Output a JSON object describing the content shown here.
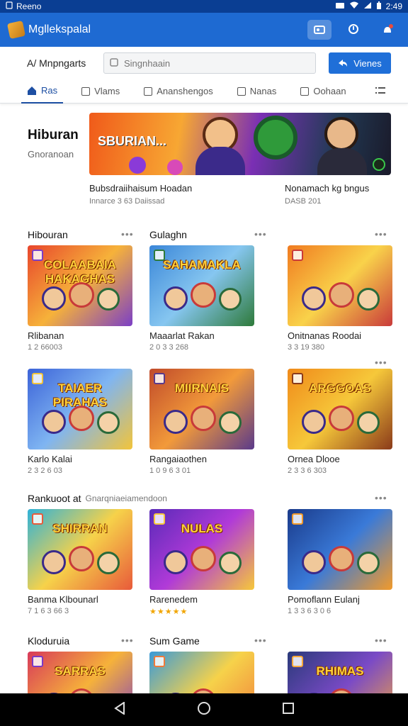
{
  "status_bar": {
    "left_text": "Reeno",
    "time": "2:49"
  },
  "app_bar": {
    "title": "Mgllekspalal"
  },
  "search": {
    "label": "A/ Mnpngarts",
    "placeholder": "Singnhaain",
    "button_label": "Vienes"
  },
  "tabs": [
    {
      "label": "Ras"
    },
    {
      "label": "Vlams"
    },
    {
      "label": "Ananshengos"
    },
    {
      "label": "Nanas"
    },
    {
      "label": "Oohaan"
    }
  ],
  "hero": {
    "title": "Hiburan",
    "subtitle": "Gnoranoan",
    "banner_text": "SBURIAN...",
    "caption_left": "Bubsdraiihaisum Hoadan",
    "meta_left": "Innarce 3 63 Daiissad",
    "caption_right": "Nonamach kg bngus",
    "meta_right": "DASB 201"
  },
  "sections": [
    {
      "title": "Hibouran",
      "second_title": "Gulaghn",
      "cards": [
        {
          "thumb_title": "COLAABAIA\nHAKAGHAS",
          "name": "Rlibanan",
          "meta": "1 2 66003",
          "palette": [
            "#e8452c",
            "#f6b23a",
            "#7b3fc6"
          ]
        },
        {
          "thumb_title": "SAHAMAKLA",
          "name": "Maaarlat Rakan",
          "meta": "2 0 3 3 268",
          "palette": [
            "#3a86d8",
            "#86c6f0",
            "#2e7a3a"
          ]
        },
        {
          "thumb_title": "",
          "name": "Onitnanas Roodai",
          "meta": "3 3 19 380",
          "palette": [
            "#f07a20",
            "#f9d24a",
            "#c93a3a"
          ]
        }
      ]
    },
    {
      "title": "",
      "second_title": "",
      "cards": [
        {
          "thumb_title": "TAIAER\nPIRAHAS",
          "name": "Karlo Kalai",
          "meta": "2 3 2 6 03",
          "palette": [
            "#3c63d8",
            "#7fb5f2",
            "#f2c43a"
          ]
        },
        {
          "thumb_title": "MIIRNAIS",
          "name": "Rangaiaothen",
          "meta": "1 0 9 6 3 01",
          "palette": [
            "#c04a2a",
            "#f29a3a",
            "#5a3a8a"
          ]
        },
        {
          "thumb_title": "ARGGOAS",
          "name": "Ornea Dlooe",
          "meta": "2 3 3 6 303",
          "palette": [
            "#f08a1a",
            "#f6c83a",
            "#8a3a1a"
          ]
        }
      ]
    },
    {
      "title": "Rankuoot at",
      "subtitle_suffix": "Gnarqniaeiamendoon",
      "cards": [
        {
          "thumb_title": "SHIRRAN",
          "name": "Banma Klbounarl",
          "meta": "7 1 6 3 66 3",
          "palette": [
            "#2fb2d8",
            "#f6d24a",
            "#e85a3a"
          ]
        },
        {
          "thumb_title": "NULAS",
          "name": "Rarenedem",
          "meta": "★★★★★",
          "palette": [
            "#5a2ab8",
            "#b03ad8",
            "#f6c83a"
          ]
        },
        {
          "thumb_title": "",
          "name": "Pomoflann Eulanj",
          "meta": "1 3 3 6 3 0 6",
          "palette": [
            "#1a3a8a",
            "#3a7ad8",
            "#f29a2a"
          ]
        }
      ]
    },
    {
      "title": "Kloduruia",
      "second_title": "Sum Game",
      "cards": [
        {
          "thumb_title": "SARRAS",
          "name": "",
          "meta": "",
          "palette": [
            "#d83a5a",
            "#f6b23a",
            "#7a3ac6"
          ]
        },
        {
          "thumb_title": "",
          "name": "",
          "meta": "",
          "palette": [
            "#3a9ad8",
            "#f6d24a",
            "#f07a3a"
          ]
        },
        {
          "thumb_title": "RHIMAS",
          "name": "",
          "meta": "",
          "palette": [
            "#2a3a7a",
            "#7a4ac6",
            "#f6a83a"
          ]
        }
      ]
    }
  ],
  "colors": {
    "status_bar": "#0a3e93",
    "app_bar": "#1e6ad2",
    "primary": "#1f6fd8",
    "active_tab": "#1d4fa3"
  }
}
